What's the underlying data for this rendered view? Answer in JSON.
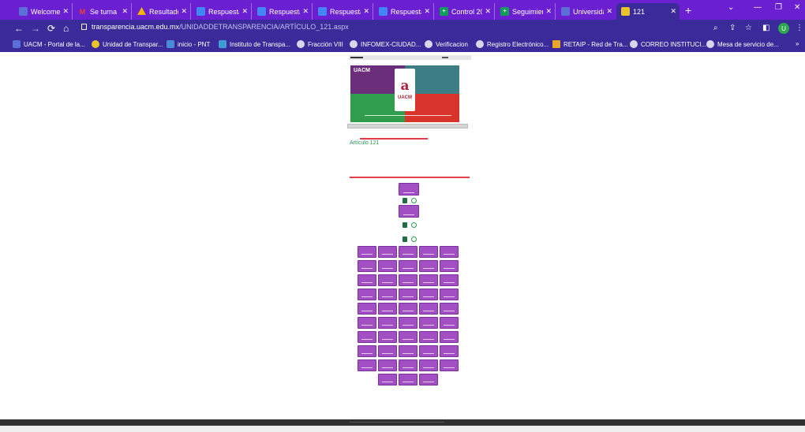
{
  "browser": {
    "tabs": [
      {
        "title": "Welcome",
        "favicon": "uacm-icon",
        "color": "#5b6fd6"
      },
      {
        "title": "Se turna p",
        "favicon": "gmail-icon",
        "color": "#ffffff"
      },
      {
        "title": "Resultado",
        "favicon": "drive-icon",
        "color": "#f4b400"
      },
      {
        "title": "Respuesta",
        "favicon": "docs-icon",
        "color": "#4285f4"
      },
      {
        "title": "Respuesta",
        "favicon": "docs-icon",
        "color": "#4285f4"
      },
      {
        "title": "Respuesta",
        "favicon": "docs-icon",
        "color": "#4285f4"
      },
      {
        "title": "Respuesta",
        "favicon": "docs-icon",
        "color": "#4285f4"
      },
      {
        "title": "Control 20",
        "favicon": "sheets-icon",
        "color": "#0f9d58"
      },
      {
        "title": "Seguimien",
        "favicon": "sheets-icon",
        "color": "#0f9d58"
      },
      {
        "title": "Universida",
        "favicon": "uacm-icon",
        "color": "#5b6fd6"
      },
      {
        "title": "121",
        "favicon": "transparency-icon",
        "color": "#e8c32a"
      }
    ],
    "url_host": "transparencia.uacm.edu.mx",
    "url_path": "/UNIDADDETRANSPARENCIA/ARTÍCULO_121.aspx",
    "profile_initial": "U",
    "bookmarks": [
      {
        "label": "UACM - Portal de la...",
        "favicon": "uacm-icon"
      },
      {
        "label": "Unidad de Transpar...",
        "favicon": "transparency-icon"
      },
      {
        "label": "inicio - PNT",
        "favicon": "pnt-icon"
      },
      {
        "label": "Instituto de Transpa...",
        "favicon": "info-icon"
      },
      {
        "label": "Fracción VIII",
        "favicon": "globe-icon"
      },
      {
        "label": "INFOMEX-CIUDAD...",
        "favicon": "globe-icon"
      },
      {
        "label": "Verificacion",
        "favicon": "globe-icon"
      },
      {
        "label": "Registro Electrónico...",
        "favicon": "globe-icon"
      },
      {
        "label": "RETAIP - Red de Tra...",
        "favicon": "retaip-icon"
      },
      {
        "label": "CORREO INSTITUCI...",
        "favicon": "globe-icon"
      },
      {
        "label": "Mesa de servicio de...",
        "favicon": "globe-icon"
      }
    ],
    "more_bookmarks": "»"
  },
  "page": {
    "banner_brand": "UACM",
    "banner_logo_main": "a",
    "banner_logo_sub": "UACM",
    "article_title": "Artículo 121",
    "colors": {
      "purple_button": "#a34fc4",
      "green_text": "#2f8c54",
      "red_rule": "#e03c49"
    }
  }
}
